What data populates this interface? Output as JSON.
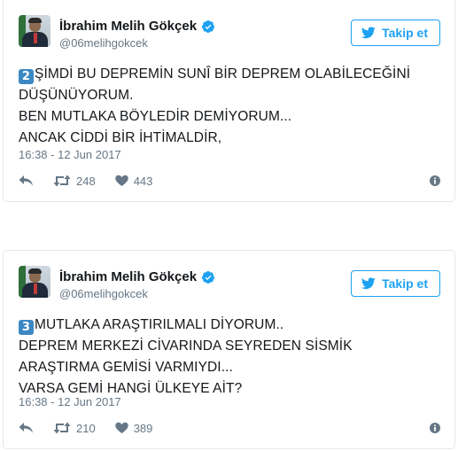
{
  "tweets": [
    {
      "author_name": "İbrahim Melih Gökçek",
      "handle": "@06melihgokcek",
      "follow_label": "Takip et",
      "keycap": "2",
      "lines": [
        "ŞİMDİ BU DEPREMİN SUNÎ BİR DEPREM OLABİLECEĞİNİ",
        "DÜŞÜNÜYORUM.",
        "BEN MUTLAKA BÖYLEDİR DEMİYORUM...",
        "ANCAK CİDDİ BİR İHTİMALDİR,"
      ],
      "timestamp": "16:38 - 12 Jun 2017",
      "retweets": "248",
      "likes": "443"
    },
    {
      "author_name": "İbrahim Melih Gökçek",
      "handle": "@06melihgokcek",
      "follow_label": "Takip et",
      "keycap": "3",
      "lines": [
        "MUTLAKA ARAŞTIRILMALI DİYORUM..",
        "DEPREM MERKEZİ CİVARINDA SEYREDEN SİSMİK",
        "ARAŞTIRMA GEMİSİ VARMIYDI...",
        "VARSA GEMİ HANGİ ÜLKEYE AİT?"
      ],
      "timestamp": "16:38 - 12 Jun 2017",
      "retweets": "210",
      "likes": "389"
    }
  ],
  "colors": {
    "accent": "#1da1f2",
    "muted": "#657786",
    "keycap": "#3b88c3",
    "border": "#e1e8ed"
  },
  "icons": [
    "verified-badge-icon",
    "twitter-bird-icon",
    "reply-icon",
    "retweet-icon",
    "heart-icon",
    "info-icon"
  ]
}
